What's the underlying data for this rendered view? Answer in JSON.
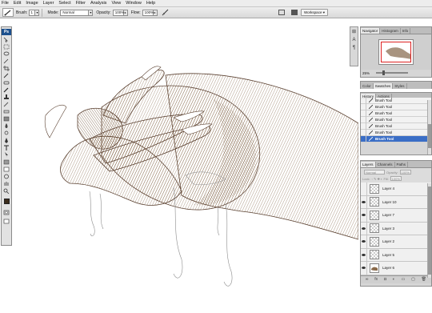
{
  "menu": [
    "File",
    "Edit",
    "Image",
    "Layer",
    "Select",
    "Filter",
    "Analysis",
    "View",
    "Window",
    "Help"
  ],
  "options": {
    "brush_label": "Brush:",
    "brush_size": "1",
    "mode_label": "Mode:",
    "mode_value": "Normal",
    "opacity_label": "Opacity:",
    "opacity_value": "100%",
    "flow_label": "Flow:",
    "flow_value": "100%",
    "workspace_label": "Workspace"
  },
  "toolbox": {
    "logo": "Ps",
    "foreground_color": "#3c2d1c"
  },
  "navigator": {
    "tabs": [
      "Navigator",
      "Histogram",
      "Info"
    ],
    "zoom": "25%"
  },
  "swatches_panel": {
    "tabs": [
      "Color",
      "Swatches",
      "Styles"
    ]
  },
  "history": {
    "tabs": [
      "History",
      "Actions"
    ],
    "items": [
      "Brush Tool",
      "Brush Tool",
      "Brush Tool",
      "Brush Tool",
      "Brush Tool",
      "Brush Tool",
      "Brush Tool"
    ],
    "selected_index": 6
  },
  "layers": {
    "tabs": [
      "Layers",
      "Channels",
      "Paths"
    ],
    "blend_mode": "Normal",
    "opacity_label": "Opacity:",
    "opacity_value": "100%",
    "lock_label": "Lock:",
    "fill_label": "Fill:",
    "fill_value": "100%",
    "items": [
      "Layer 4",
      "Layer 10",
      "Layer 7",
      "Layer 3",
      "Layer 2",
      "Layer 5",
      "Layer 6"
    ]
  }
}
